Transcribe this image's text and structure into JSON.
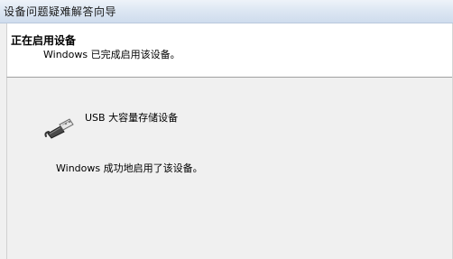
{
  "window": {
    "title": "设备问题疑难解答向导"
  },
  "header": {
    "title": "正在启用设备",
    "subtitle": "Windows 已完成启用该设备。"
  },
  "body": {
    "device_icon": "usb-plug-icon",
    "device_name": "USB 大容量存储设备",
    "result_message": "Windows 成功地启用了该设备。"
  }
}
